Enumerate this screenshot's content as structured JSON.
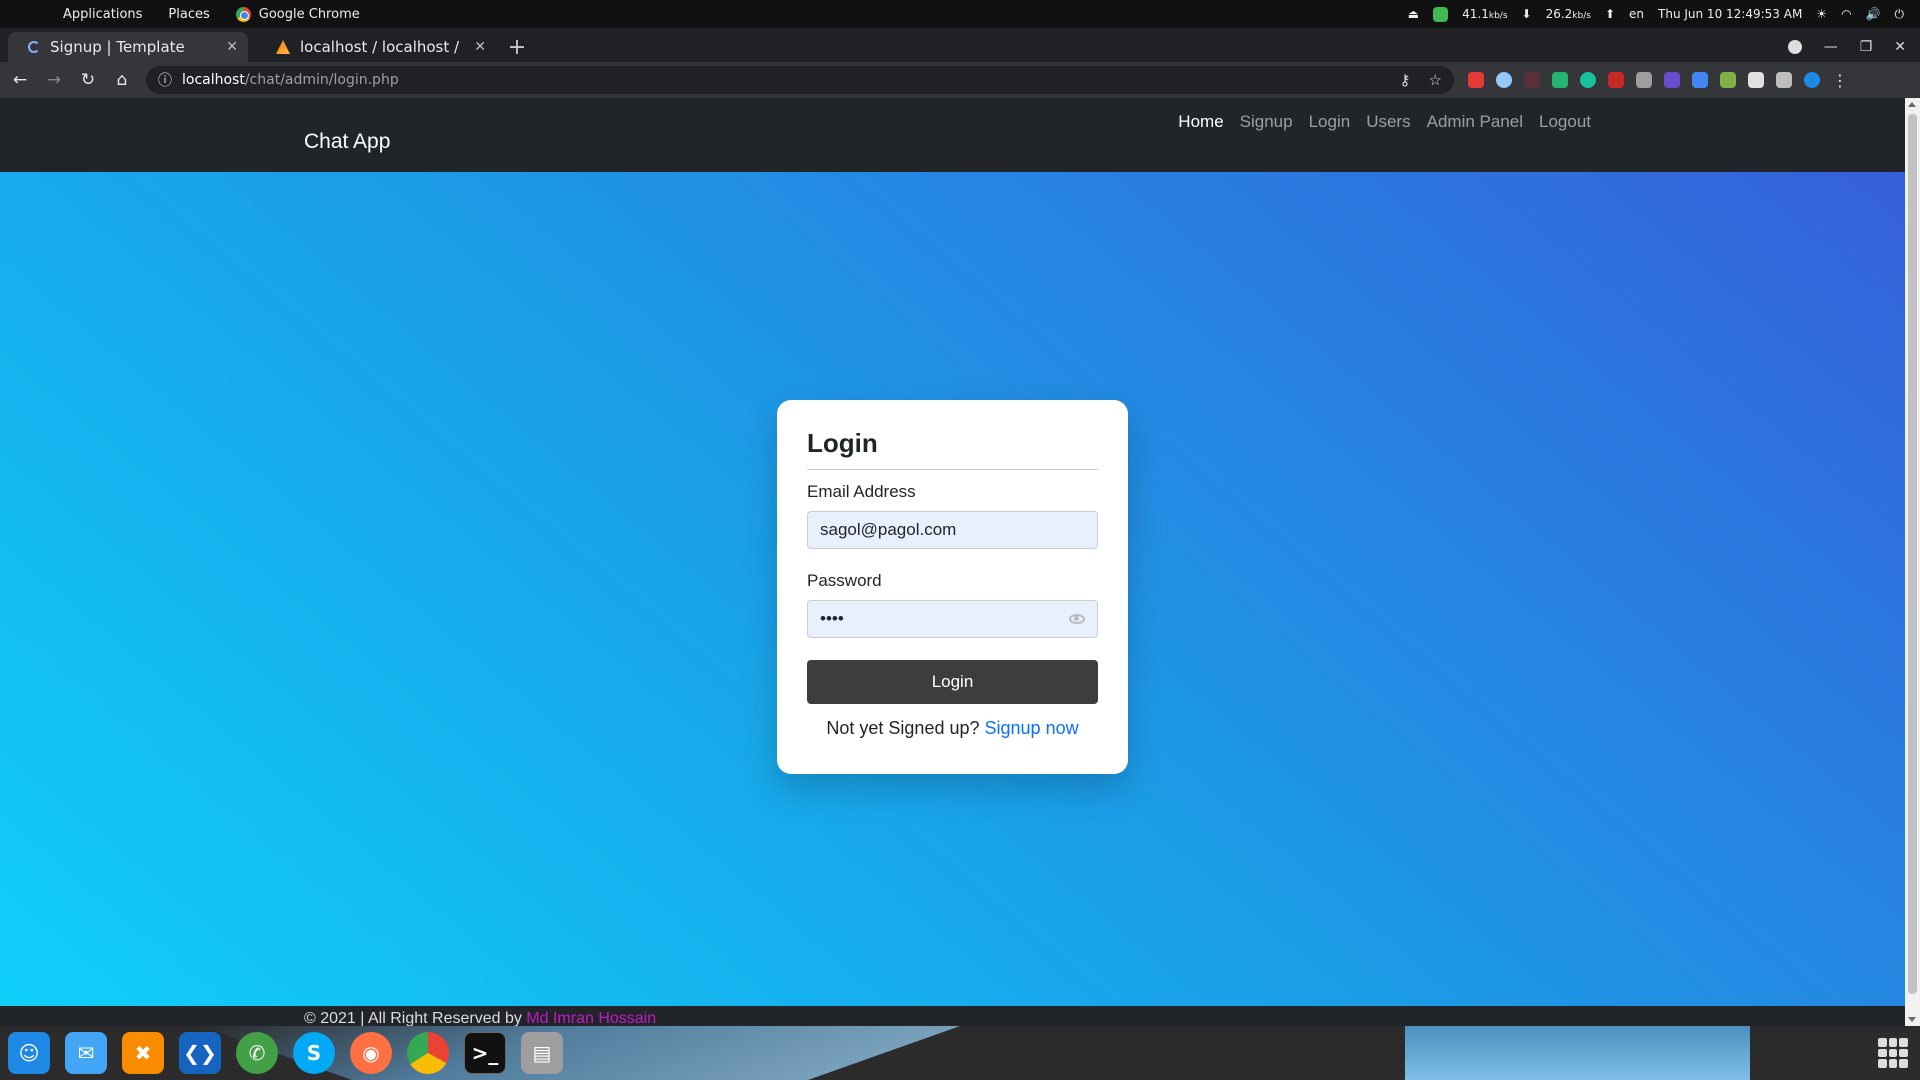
{
  "os": {
    "menus": [
      "Applications",
      "Places",
      "Google Chrome"
    ],
    "net_down": "41.1",
    "net_down_unit": "kb/s",
    "net_up": "26.2",
    "net_up_unit": "kb/s",
    "lang": "en",
    "clock": "Thu Jun 10  12:49:53 AM"
  },
  "browser": {
    "tabs": [
      {
        "title": "Signup | Template"
      },
      {
        "title": "localhost / localhost / cha"
      }
    ],
    "url_host": "localhost",
    "url_path": "/chat/admin/login.php"
  },
  "site": {
    "brand": "Chat App",
    "nav": [
      "Home",
      "Signup",
      "Login",
      "Users",
      "Admin Panel",
      "Logout"
    ]
  },
  "form": {
    "title": "Login",
    "email_label": "Email Address",
    "email_value": "sagol@pagol.com",
    "password_label": "Password",
    "password_value": "••••",
    "submit_label": "Login",
    "signup_prompt": "Not yet Signed up?",
    "signup_link": "Signup now"
  },
  "footer": {
    "text": "© 2021 | All Right Reserved by",
    "author": "Md Imran Hossain"
  },
  "colors": {
    "gradient_start": "#10d0fa",
    "gradient_end": "#3660da",
    "navbar": "#212529",
    "button": "#3d3d3d",
    "link": "#0d6efd",
    "author": "#c418c8"
  }
}
